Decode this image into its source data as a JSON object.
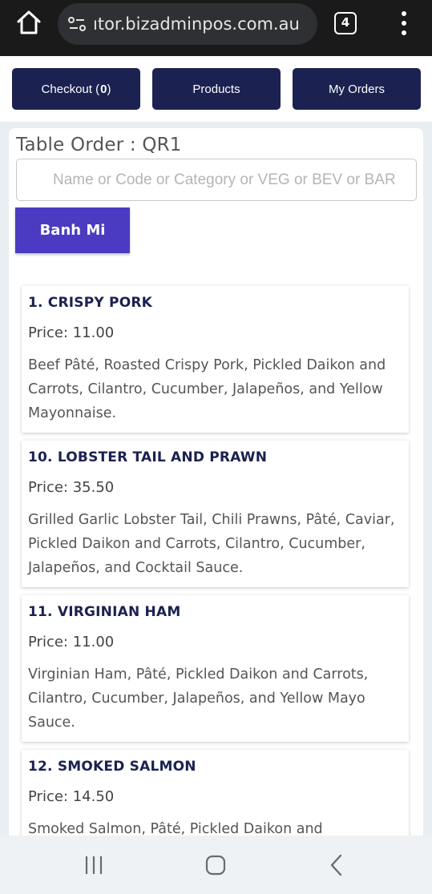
{
  "browser": {
    "url": "ıtor.bizadminpos.com.au",
    "tab_count": "4"
  },
  "nav": {
    "checkout_label": "Checkout (",
    "checkout_count": "0",
    "checkout_suffix": ")",
    "products_label": "Products",
    "orders_label": "My Orders"
  },
  "page": {
    "title": "Table Order : QR1",
    "search_placeholder": "Name or Code or Category or VEG or BEV or BAR",
    "category_label": "Banh Mi"
  },
  "products": [
    {
      "name": "1. CRISPY PORK",
      "price": "Price: 11.00",
      "description": "Beef Pâté, Roasted Crispy Pork, Pickled Daikon and Carrots, Cilantro, Cucumber, Jalapeños, and Yellow Mayonnaise."
    },
    {
      "name": "10. LOBSTER TAIL AND PRAWN",
      "price": "Price: 35.50",
      "description": "Grilled Garlic Lobster Tail, Chili Prawns, Pâté, Caviar, Pickled Daikon and Carrots, Cilantro, Cucumber, Jalapeños, and Cocktail Sauce."
    },
    {
      "name": "11. VIRGINIAN HAM",
      "price": "Price: 11.00",
      "description": "Virginian Ham, Pâté, Pickled Daikon and Carrots, Cilantro, Cucumber, Jalapeños, and Yellow Mayo Sauce."
    },
    {
      "name": "12. SMOKED SALMON",
      "price": "Price: 14.50",
      "description": "Smoked Salmon, Pâté, Pickled Daikon and"
    }
  ],
  "icons": {
    "home": "home-icon",
    "site_settings": "site-settings-icon",
    "tabs": "tabs-icon",
    "menu": "more-vert-icon",
    "recents": "recents-icon",
    "home_nav": "android-home-icon",
    "back": "back-icon"
  },
  "colors": {
    "nav_button": "#1b2150",
    "category_button": "#4a3bc2",
    "product_name": "#1b2150"
  }
}
